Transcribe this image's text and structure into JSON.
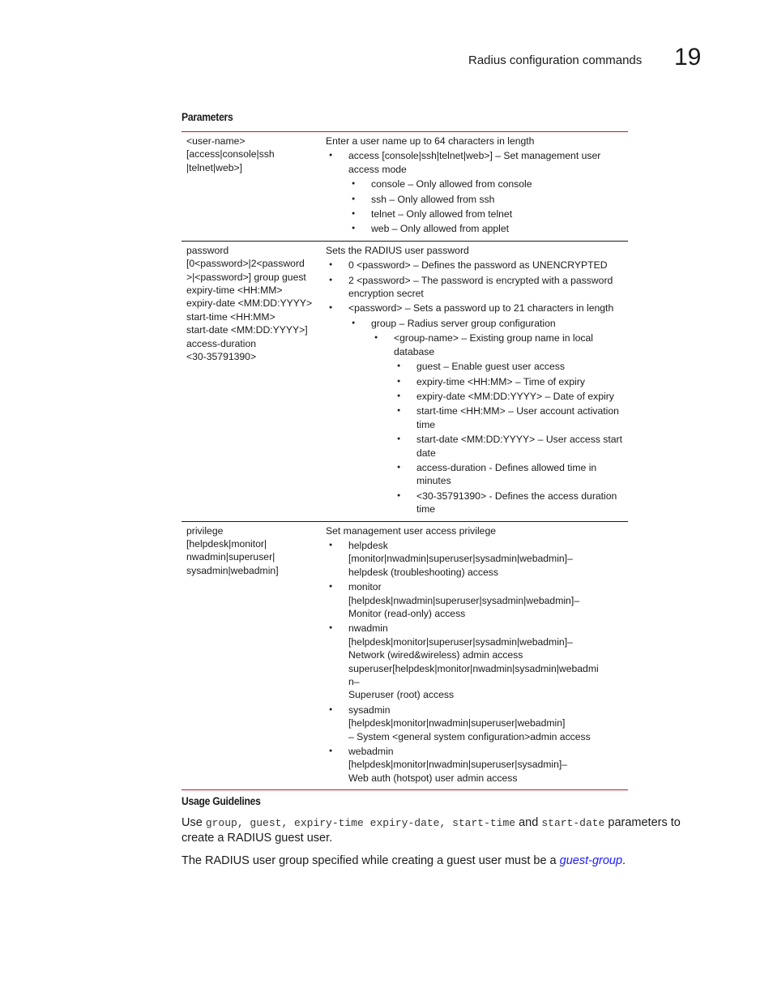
{
  "header": {
    "title": "Radius configuration commands",
    "chapter": "19"
  },
  "parameters": {
    "heading": "Parameters",
    "rows": [
      {
        "param_lines": [
          "<user-name>",
          "[access|console|ssh",
          "|telnet|web>]"
        ],
        "description": "Enter a user name up to 64 characters in length",
        "items": [
          {
            "level": 1,
            "text": "access [console|ssh|telnet|web>] – Set management user access mode"
          },
          {
            "level": 2,
            "text": "console – Only allowed from console"
          },
          {
            "level": 2,
            "text": "ssh – Only allowed from ssh"
          },
          {
            "level": 2,
            "text": "telnet – Only allowed from telnet"
          },
          {
            "level": 2,
            "text": "web – Only allowed from applet"
          }
        ]
      },
      {
        "param_lines": [
          "password",
          "[0<password>|2<password",
          ">|<password>] group guest",
          "expiry-time <HH:MM>",
          "expiry-date <MM:DD:YYYY>",
          "start-time <HH:MM>",
          "start-date <MM:DD:YYYY>]",
          "access-duration",
          "<30-35791390>"
        ],
        "description": "Sets the RADIUS user password",
        "items": [
          {
            "level": 1,
            "text": "0 <password> – Defines the password as UNENCRYPTED"
          },
          {
            "level": 1,
            "text": "2 <password> – The password is encrypted with a password encryption secret"
          },
          {
            "level": 1,
            "text": "<password> – Sets a password up to 21 characters in length"
          },
          {
            "level": 2,
            "text": "group – Radius server group configuration"
          },
          {
            "level": 3,
            "text": "<group-name> – Existing group name in local database"
          },
          {
            "level": 4,
            "text": "guest – Enable guest user access"
          },
          {
            "level": 4,
            "text": "expiry-time <HH:MM> – Time of expiry"
          },
          {
            "level": 4,
            "text": "expiry-date <MM:DD:YYYY> – Date of expiry"
          },
          {
            "level": 4,
            "text": "start-time <HH:MM> – User account activation time"
          },
          {
            "level": 4,
            "text": "start-date <MM:DD:YYYY> – User access start date"
          },
          {
            "level": 4,
            "text": "access-duration - Defines allowed time in minutes"
          },
          {
            "level": 4,
            "text": "<30-35791390> - Defines the access duration time"
          }
        ]
      },
      {
        "param_lines": [
          "privilege",
          "[helpdesk|monitor|",
          "nwadmin|superuser|",
          "sysadmin|webadmin]"
        ],
        "description": "Set management user access privilege",
        "items": [
          {
            "level": 1,
            "lines": [
              "helpdesk",
              "[monitor|nwadmin|superuser|sysadmin|webadmin]–",
              "helpdesk (troubleshooting) access"
            ]
          },
          {
            "level": 1,
            "lines": [
              "monitor",
              "[helpdesk|nwadmin|superuser|sysadmin|webadmin]–",
              "Monitor (read-only) access"
            ]
          },
          {
            "level": 1,
            "lines": [
              "nwadmin",
              "[helpdesk|monitor|superuser|sysadmin|webadmin]–",
              "Network (wired&wireless) admin access",
              "superuser[helpdesk|monitor|nwadmin|sysadmin|webadmi",
              "n–",
              "Superuser (root) access"
            ]
          },
          {
            "level": 1,
            "lines": [
              "sysadmin",
              "[helpdesk|monitor|nwadmin|superuser|webadmin]",
              "– System <general system configuration>admin access"
            ]
          },
          {
            "level": 1,
            "lines": [
              "webadmin",
              "[helpdesk|monitor|nwadmin|superuser|sysadmin]–",
              "Web auth (hotspot) user admin access"
            ]
          }
        ]
      }
    ]
  },
  "usage": {
    "heading": "Usage Guidelines",
    "p1_prefix": "Use ",
    "p1_code1": "group, guest, expiry-time expiry-date, start-time",
    "p1_and": " and ",
    "p1_code2": "start-date",
    "p1_suffix": " parameters to create a RADIUS guest user.",
    "p2_prefix": "The RADIUS user group specified while creating a guest user must be a ",
    "p2_link": "guest-group",
    "p2_suffix": "."
  },
  "colors": {
    "rule_accent": "#c8102e",
    "link": "#1a1aff"
  }
}
